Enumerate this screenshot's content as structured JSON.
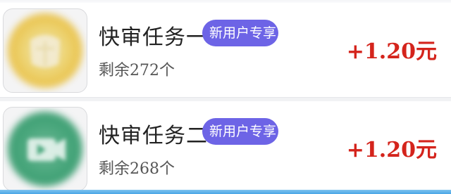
{
  "tasks": [
    {
      "title": "快审任务一",
      "badge": "新用户专享",
      "remaining": "剩余272个",
      "reward": "+1.20元",
      "thumbnail_color": "#e9c24b",
      "thumbnail_icon": "gift-icon"
    },
    {
      "title": "快审任务二",
      "badge": "新用户专享",
      "remaining": "剩余268个",
      "reward": "+1.20元",
      "thumbnail_color": "#46a57a",
      "thumbnail_icon": "video-icon"
    }
  ],
  "colors": {
    "badge_bg": "#6d64e6",
    "reward": "#d4241c"
  }
}
